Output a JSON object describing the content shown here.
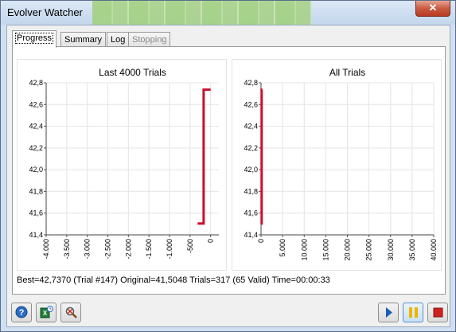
{
  "window": {
    "title": "Evolver Watcher",
    "close_label": "✕"
  },
  "tabs": [
    {
      "label": "Progress",
      "state": "active"
    },
    {
      "label": "Summary",
      "state": "normal"
    },
    {
      "label": "Log",
      "state": "normal"
    },
    {
      "label": "Stopping Options",
      "state": "disabled"
    }
  ],
  "status_text": "Best=42,7370 (Trial #147) Original=41,5048 Trials=317 (65 Valid) Time=00:00:33",
  "toolbar": {
    "left_icons": [
      "help-icon",
      "excel-report-icon",
      "zoom-icon"
    ],
    "right_icons": [
      "play-icon",
      "pause-icon",
      "stop-icon"
    ]
  },
  "colors": {
    "series": "#c8102e",
    "pause": "#f0b400",
    "stop": "#d02020",
    "play": "#1a5fb4"
  },
  "chart_data": [
    {
      "type": "line",
      "title": "Last 4000 Trials",
      "ylim": [
        41.4,
        42.8
      ],
      "yticks": [
        "41,4",
        "41,6",
        "41,8",
        "42,0",
        "42,2",
        "42,4",
        "42,6",
        "42,8"
      ],
      "xlim": [
        -4000,
        200
      ],
      "xticks": [
        "-4.000",
        "-3.500",
        "-3.000",
        "-2.500",
        "-2.000",
        "-1.500",
        "-1.000",
        "-500",
        "0"
      ],
      "xtick_values": [
        -4000,
        -3500,
        -3000,
        -2500,
        -2000,
        -1500,
        -1000,
        -500,
        0
      ],
      "grid": true,
      "series": [
        {
          "x": [
            -316,
            -170,
            -170,
            0
          ],
          "y": [
            41.5048,
            41.5048,
            42.737,
            42.737
          ]
        }
      ]
    },
    {
      "type": "line",
      "title": "All Trials",
      "ylim": [
        41.4,
        42.8
      ],
      "yticks": [
        "41,4",
        "41,6",
        "41,8",
        "42,0",
        "42,2",
        "42,4",
        "42,6",
        "42,8"
      ],
      "xlim": [
        0,
        40000
      ],
      "xticks": [
        "0",
        "5.000",
        "10.000",
        "15.000",
        "20.000",
        "25.000",
        "30.000",
        "35.000",
        "40.000"
      ],
      "xtick_values": [
        0,
        5000,
        10000,
        15000,
        20000,
        25000,
        30000,
        35000,
        40000
      ],
      "grid": true,
      "series": [
        {
          "x": [
            0,
            147,
            147,
            317
          ],
          "y": [
            41.5048,
            41.5048,
            42.737,
            42.737
          ]
        }
      ]
    }
  ]
}
